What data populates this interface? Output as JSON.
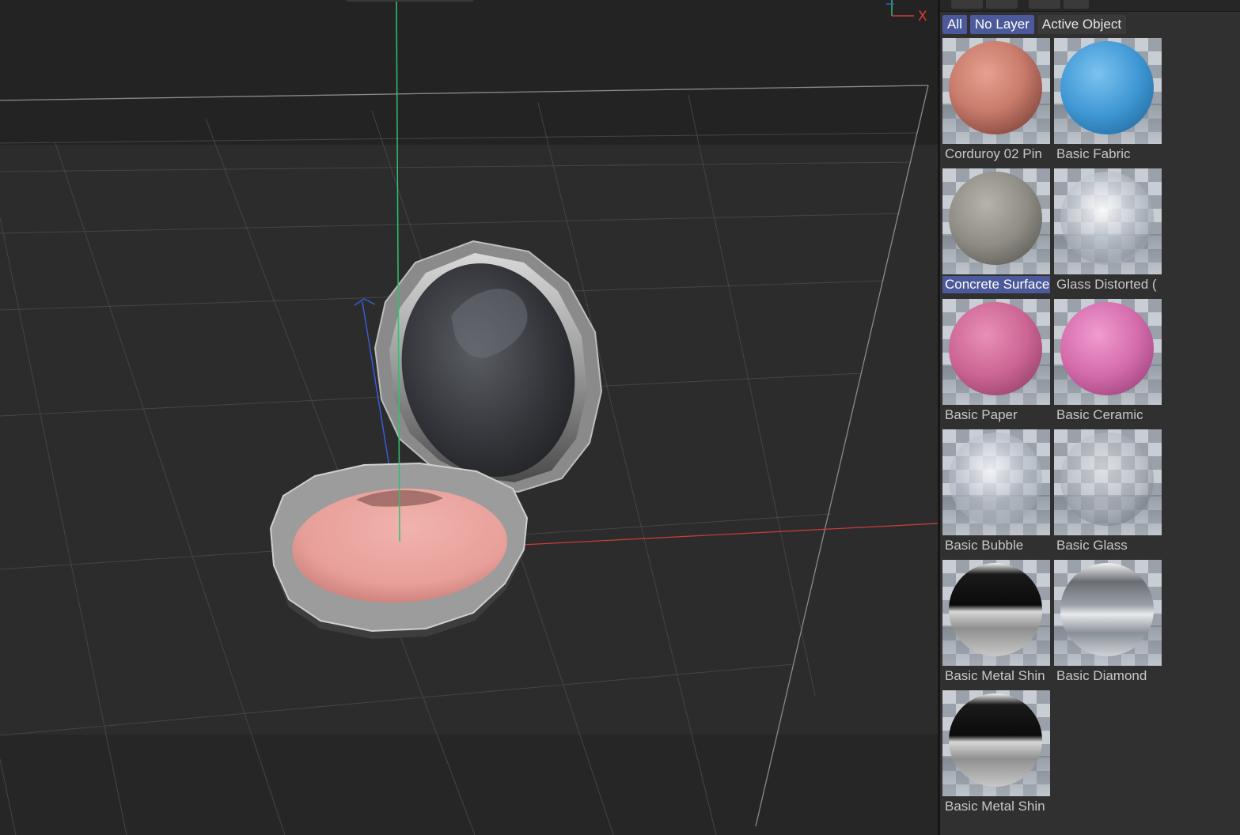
{
  "viewport": {
    "axis_label": "X",
    "colors": {
      "x_axis": "#d23b3b",
      "y_axis": "#2fc26e",
      "z_axis": "#3b5bd6",
      "grid": "#4a4a4a"
    }
  },
  "material_manager": {
    "filters": [
      {
        "label": "All",
        "active": true
      },
      {
        "label": "No Layer",
        "active": true
      },
      {
        "label": "Active Object",
        "active": false
      }
    ],
    "materials": [
      {
        "name": "Corduroy 02 Pin",
        "style": "corduroy"
      },
      {
        "name": "Basic Fabric",
        "style": "fabric"
      },
      {
        "name": "Concrete Surface",
        "style": "concrete",
        "selected": true
      },
      {
        "name": "Glass Distorted (",
        "style": "glassdist"
      },
      {
        "name": "Basic Paper",
        "style": "paper"
      },
      {
        "name": "Basic Ceramic",
        "style": "ceramic"
      },
      {
        "name": "Basic Bubble",
        "style": "bubble"
      },
      {
        "name": "Basic Glass",
        "style": "glass"
      },
      {
        "name": "Basic Metal Shin",
        "style": "metal"
      },
      {
        "name": "Basic Diamond",
        "style": "diamond"
      },
      {
        "name": "Basic Metal Shin",
        "style": "metal"
      }
    ]
  }
}
